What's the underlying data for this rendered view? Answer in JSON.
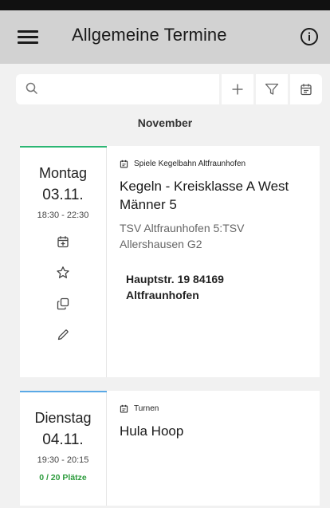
{
  "header": {
    "title": "Allgemeine Termine",
    "menu_icon": "menu-icon",
    "info_icon": "info-icon"
  },
  "search": {
    "placeholder": "",
    "value": ""
  },
  "toolbar": {
    "add_icon": "plus-icon",
    "filter_icon": "filter-icon",
    "calendar_icon": "calendar-icon"
  },
  "month_header": "November",
  "events": [
    {
      "weekday": "Montag",
      "date": "03.11.",
      "time": "18:30  -  22:30",
      "accent_color": "#2bb673",
      "category": "Spiele Kegelbahn Altfraunhofen",
      "title": "Kegeln - Kreisklasse A West Männer 5",
      "description": "TSV Altfraunhofen 5:TSV Allershausen G2",
      "address": "Hauptstr. 19 84169 Altfraunhofen",
      "actions": [
        "calendar-add-icon",
        "star-icon",
        "copy-icon",
        "edit-pencil-icon"
      ]
    },
    {
      "weekday": "Dienstag",
      "date": "04.11.",
      "time": "19:30  -  20:15",
      "spots": "0 / 20 Plätze",
      "accent_color": "#5aa9e6",
      "category": "Turnen",
      "title": "Hula Hoop"
    }
  ],
  "colors": {
    "appbar": "#d2d2d2",
    "background": "#f1f1f1",
    "spots_green": "#2e9c3e"
  }
}
